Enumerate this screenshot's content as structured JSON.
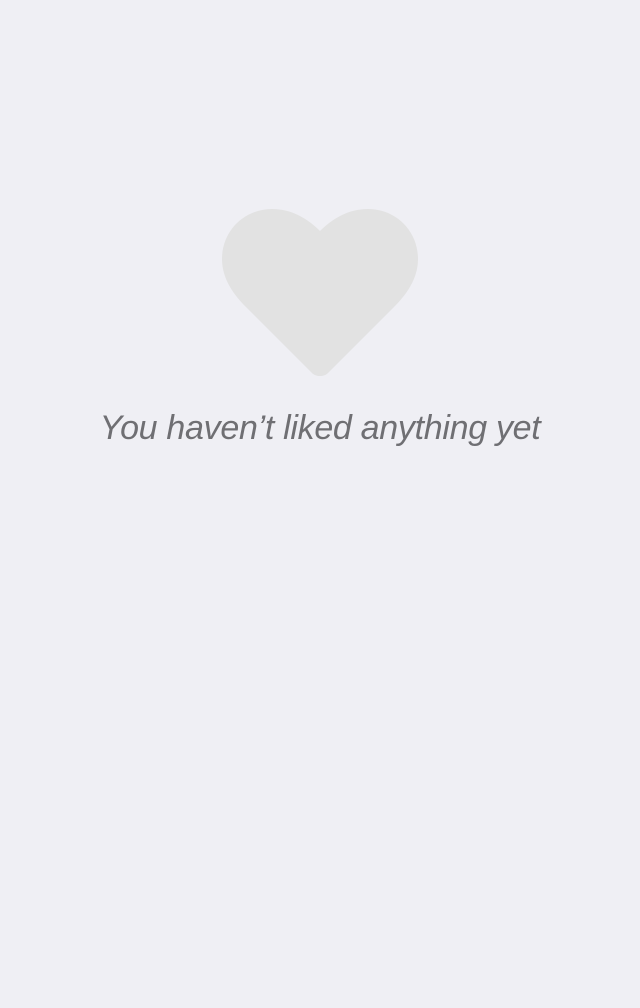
{
  "empty_state": {
    "icon": "heart-icon",
    "icon_color": "#e2e2e2",
    "message": "You haven’t liked anything yet",
    "message_color": "#6f6f73"
  },
  "theme": {
    "background": "#efeff4"
  }
}
